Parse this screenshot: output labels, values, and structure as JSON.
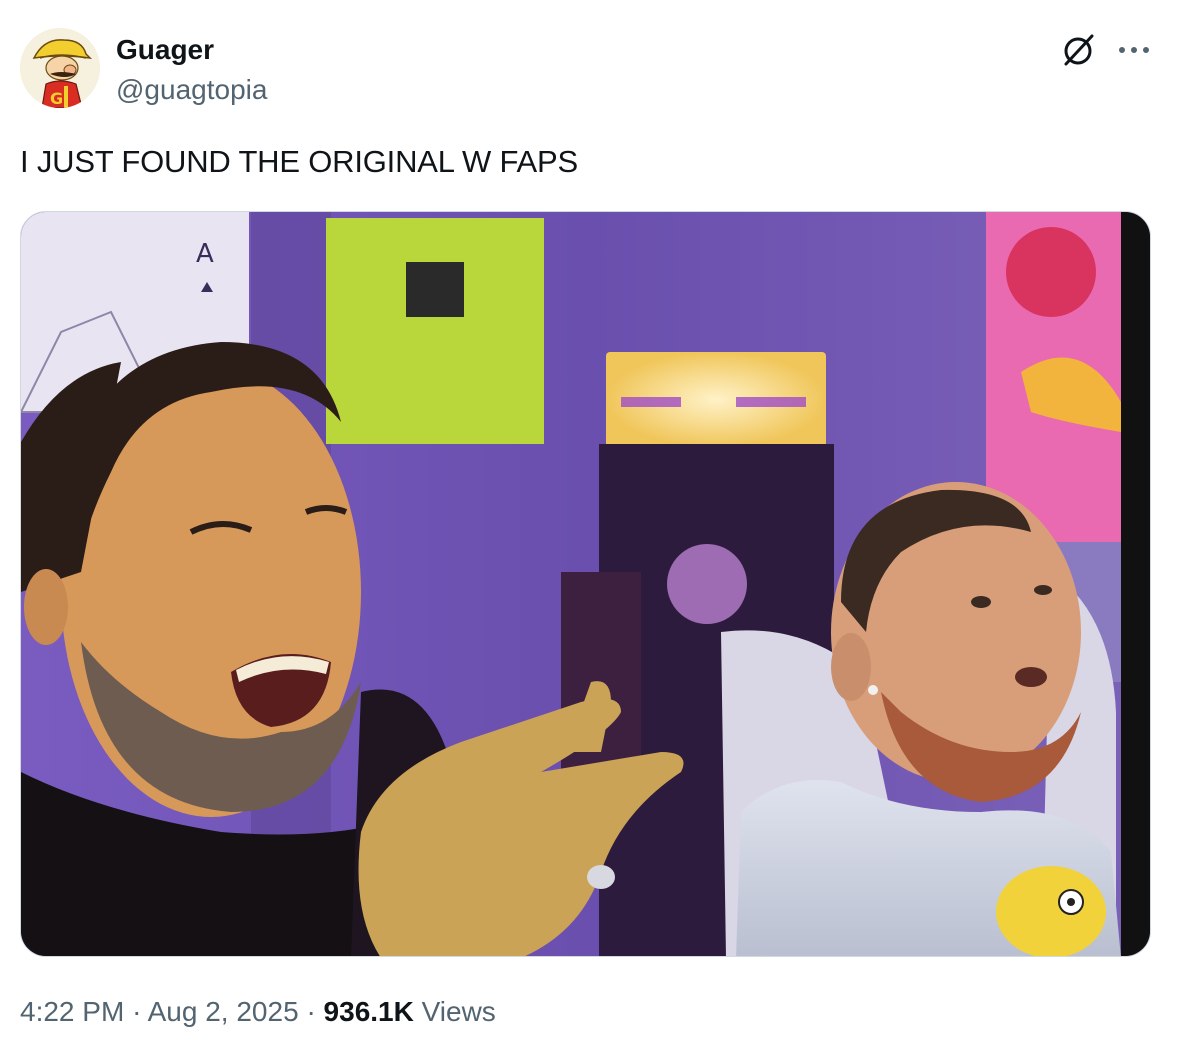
{
  "author": {
    "name": "Guager",
    "handle": "@guagtopia"
  },
  "tweet": {
    "text": "I JUST FOUND THE ORIGINAL W FAPS"
  },
  "meta": {
    "time": "4:22 PM",
    "separator": "·",
    "date": "Aug 2, 2025",
    "views_count": "936.1K",
    "views_label": "Views"
  },
  "icons": {
    "grok": "grok-icon",
    "more": "more-icon"
  },
  "colors": {
    "text_primary": "#0f1419",
    "text_secondary": "#536471",
    "border": "#cfd9de"
  }
}
